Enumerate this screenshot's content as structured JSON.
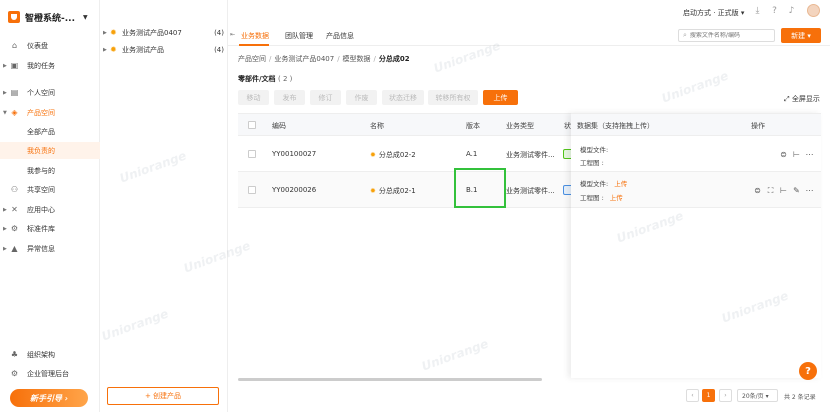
{
  "brand": {
    "title": "智橙系统-..."
  },
  "sidebar": {
    "items": [
      {
        "label": "仪表盘",
        "icon": "home-icon"
      },
      {
        "label": "我的任务",
        "icon": "task-icon"
      },
      {
        "label": "个人空间",
        "icon": "user-icon"
      },
      {
        "label": "产品空间",
        "icon": "cube-icon"
      },
      {
        "label": "全部产品"
      },
      {
        "label": "我负责的"
      },
      {
        "label": "我参与的"
      },
      {
        "label": "共享空间",
        "icon": "share-icon"
      },
      {
        "label": "应用中心",
        "icon": "tools-icon"
      },
      {
        "label": "标准件库",
        "icon": "gear-icon"
      },
      {
        "label": "异常信息",
        "icon": "warning-icon"
      }
    ],
    "bottom": [
      {
        "label": "组织架构",
        "icon": "org-icon"
      },
      {
        "label": "企业管理后台",
        "icon": "admin-icon"
      }
    ],
    "guide_label": "新手引导 ›"
  },
  "tree": {
    "items": [
      {
        "label": "业务测试产品0407",
        "count": "(4)"
      },
      {
        "label": "业务测试产品",
        "count": "(4)"
      }
    ],
    "create_label": "+ 创建产品"
  },
  "topbar": {
    "launch_label": "启动方式 · 正式版 ▾"
  },
  "tabs": [
    {
      "label": "业务数据"
    },
    {
      "label": "团队管理"
    },
    {
      "label": "产品信息"
    }
  ],
  "search": {
    "placeholder": "搜索文件名称/编码"
  },
  "new_button": "新建 ▾",
  "breadcrumb": [
    "产品空间",
    "业务测试产品0407",
    "模型数据",
    "分总成02"
  ],
  "section": {
    "title": "零部件/文档",
    "count": "( 2 )"
  },
  "toolbar": [
    "移动",
    "发布",
    "修订",
    "作废",
    "状态迁移",
    "转移所有权",
    "上传"
  ],
  "fullscreen_label": "⤢ 全屏显示",
  "table": {
    "headers": [
      "编码",
      "名称",
      "版本",
      "业务类型",
      "状"
    ],
    "rows": [
      {
        "code": "YY00100027",
        "name": "分总成02-2",
        "version": "A.1",
        "type": "业务测试零件...",
        "status_color": "#52c41a"
      },
      {
        "code": "YY00200026",
        "name": "分总成02-1",
        "version": "B.1",
        "type": "业务测试零件...",
        "status_color": "#4a90e2"
      }
    ]
  },
  "right_panel": {
    "headers": [
      "数据集（支持拖拽上传）",
      "操作"
    ],
    "rows": [
      {
        "model_label": "模型文件:",
        "model_link": "",
        "drawing_label": "工程图   :",
        "drawing_link": ""
      },
      {
        "model_label": "模型文件:",
        "model_link": "上传",
        "drawing_label": "工程图   :",
        "drawing_link": "上传"
      }
    ]
  },
  "pager": {
    "current": "1",
    "size": "20条/页 ▾",
    "total": "共 2 条记录"
  },
  "watermark": "Uniorange"
}
